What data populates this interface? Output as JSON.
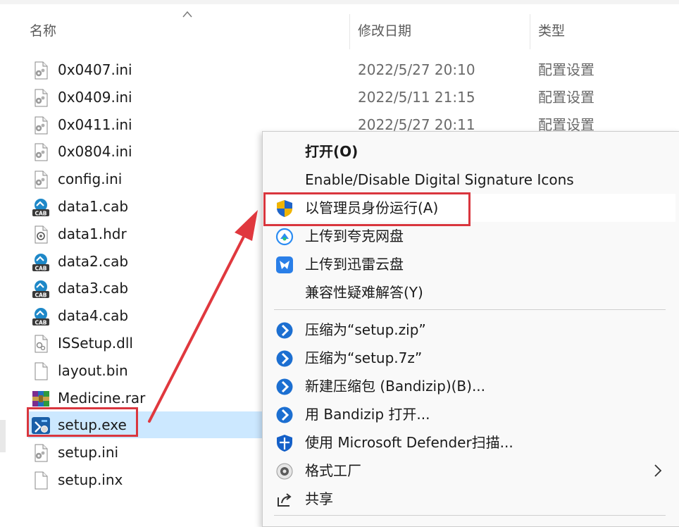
{
  "columns": {
    "name": "名称",
    "date_modified": "修改日期",
    "type": "类型"
  },
  "files": [
    {
      "name": "0x0407.ini",
      "date": "2022/5/27 20:10",
      "type": "配置设置",
      "icon": "ini-config-icon"
    },
    {
      "name": "0x0409.ini",
      "date": "2022/5/11 21:15",
      "type": "配置设置",
      "icon": "ini-config-icon"
    },
    {
      "name": "0x0411.ini",
      "date": "2022/5/27 20:11",
      "type": "配置设置",
      "icon": "ini-config-icon"
    },
    {
      "name": "0x0804.ini",
      "icon": "ini-config-icon"
    },
    {
      "name": "config.ini",
      "icon": "ini-config-icon"
    },
    {
      "name": "data1.cab",
      "icon": "cab-archive-icon"
    },
    {
      "name": "data1.hdr",
      "icon": "hdr-file-icon"
    },
    {
      "name": "data2.cab",
      "icon": "cab-archive-icon"
    },
    {
      "name": "data3.cab",
      "icon": "cab-archive-icon"
    },
    {
      "name": "data4.cab",
      "icon": "cab-archive-icon"
    },
    {
      "name": "ISSetup.dll",
      "icon": "dll-file-icon"
    },
    {
      "name": "layout.bin",
      "icon": "blank-file-icon"
    },
    {
      "name": "Medicine.rar",
      "icon": "rar-archive-icon"
    },
    {
      "name": "setup.exe",
      "icon": "installer-exe-icon",
      "selected": true
    },
    {
      "name": "setup.ini",
      "icon": "ini-config-icon"
    },
    {
      "name": "setup.inx",
      "icon": "blank-file-icon"
    }
  ],
  "context_menu": {
    "items": [
      {
        "label": "打开(O)",
        "bold": true,
        "icon": null
      },
      {
        "label": "Enable/Disable Digital Signature Icons",
        "icon": null
      },
      {
        "label": "以管理员身份运行(A)",
        "icon": "uac-shield-icon",
        "hover": true
      },
      {
        "label": "上传到夸克网盘",
        "icon": "quark-cloud-icon"
      },
      {
        "label": "上传到迅雷云盘",
        "icon": "xunlei-cloud-icon"
      },
      {
        "label": "兼容性疑难解答(Y)",
        "icon": null
      },
      {
        "separator": true
      },
      {
        "label": "压缩为“setup.zip”",
        "icon": "bandizip-icon"
      },
      {
        "label": "压缩为“setup.7z”",
        "icon": "bandizip-icon"
      },
      {
        "label": "新建压缩包 (Bandizip)(B)...",
        "icon": "bandizip-icon"
      },
      {
        "label": "用 Bandizip 打开...",
        "icon": "bandizip-icon"
      },
      {
        "label": "使用 Microsoft Defender扫描...",
        "icon": "defender-shield-icon"
      },
      {
        "label": "格式工厂",
        "icon": "format-factory-icon",
        "submenu": true
      },
      {
        "label": "共享",
        "icon": "share-icon"
      },
      {
        "separator": true
      }
    ]
  },
  "colors": {
    "selection": "#cce8ff",
    "highlight_box": "#d9363e",
    "annotation_arrow": "#e0383e"
  }
}
